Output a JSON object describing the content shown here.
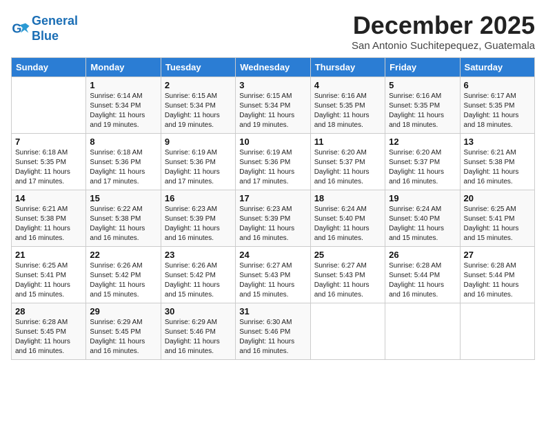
{
  "header": {
    "logo_line1": "General",
    "logo_line2": "Blue",
    "month": "December 2025",
    "location": "San Antonio Suchitepequez, Guatemala"
  },
  "columns": [
    "Sunday",
    "Monday",
    "Tuesday",
    "Wednesday",
    "Thursday",
    "Friday",
    "Saturday"
  ],
  "weeks": [
    [
      {
        "day": "",
        "info": ""
      },
      {
        "day": "1",
        "info": "Sunrise: 6:14 AM\nSunset: 5:34 PM\nDaylight: 11 hours\nand 19 minutes."
      },
      {
        "day": "2",
        "info": "Sunrise: 6:15 AM\nSunset: 5:34 PM\nDaylight: 11 hours\nand 19 minutes."
      },
      {
        "day": "3",
        "info": "Sunrise: 6:15 AM\nSunset: 5:34 PM\nDaylight: 11 hours\nand 19 minutes."
      },
      {
        "day": "4",
        "info": "Sunrise: 6:16 AM\nSunset: 5:35 PM\nDaylight: 11 hours\nand 18 minutes."
      },
      {
        "day": "5",
        "info": "Sunrise: 6:16 AM\nSunset: 5:35 PM\nDaylight: 11 hours\nand 18 minutes."
      },
      {
        "day": "6",
        "info": "Sunrise: 6:17 AM\nSunset: 5:35 PM\nDaylight: 11 hours\nand 18 minutes."
      }
    ],
    [
      {
        "day": "7",
        "info": "Sunrise: 6:18 AM\nSunset: 5:35 PM\nDaylight: 11 hours\nand 17 minutes."
      },
      {
        "day": "8",
        "info": "Sunrise: 6:18 AM\nSunset: 5:36 PM\nDaylight: 11 hours\nand 17 minutes."
      },
      {
        "day": "9",
        "info": "Sunrise: 6:19 AM\nSunset: 5:36 PM\nDaylight: 11 hours\nand 17 minutes."
      },
      {
        "day": "10",
        "info": "Sunrise: 6:19 AM\nSunset: 5:36 PM\nDaylight: 11 hours\nand 17 minutes."
      },
      {
        "day": "11",
        "info": "Sunrise: 6:20 AM\nSunset: 5:37 PM\nDaylight: 11 hours\nand 16 minutes."
      },
      {
        "day": "12",
        "info": "Sunrise: 6:20 AM\nSunset: 5:37 PM\nDaylight: 11 hours\nand 16 minutes."
      },
      {
        "day": "13",
        "info": "Sunrise: 6:21 AM\nSunset: 5:38 PM\nDaylight: 11 hours\nand 16 minutes."
      }
    ],
    [
      {
        "day": "14",
        "info": "Sunrise: 6:21 AM\nSunset: 5:38 PM\nDaylight: 11 hours\nand 16 minutes."
      },
      {
        "day": "15",
        "info": "Sunrise: 6:22 AM\nSunset: 5:38 PM\nDaylight: 11 hours\nand 16 minutes."
      },
      {
        "day": "16",
        "info": "Sunrise: 6:23 AM\nSunset: 5:39 PM\nDaylight: 11 hours\nand 16 minutes."
      },
      {
        "day": "17",
        "info": "Sunrise: 6:23 AM\nSunset: 5:39 PM\nDaylight: 11 hours\nand 16 minutes."
      },
      {
        "day": "18",
        "info": "Sunrise: 6:24 AM\nSunset: 5:40 PM\nDaylight: 11 hours\nand 16 minutes."
      },
      {
        "day": "19",
        "info": "Sunrise: 6:24 AM\nSunset: 5:40 PM\nDaylight: 11 hours\nand 15 minutes."
      },
      {
        "day": "20",
        "info": "Sunrise: 6:25 AM\nSunset: 5:41 PM\nDaylight: 11 hours\nand 15 minutes."
      }
    ],
    [
      {
        "day": "21",
        "info": "Sunrise: 6:25 AM\nSunset: 5:41 PM\nDaylight: 11 hours\nand 15 minutes."
      },
      {
        "day": "22",
        "info": "Sunrise: 6:26 AM\nSunset: 5:42 PM\nDaylight: 11 hours\nand 15 minutes."
      },
      {
        "day": "23",
        "info": "Sunrise: 6:26 AM\nSunset: 5:42 PM\nDaylight: 11 hours\nand 15 minutes."
      },
      {
        "day": "24",
        "info": "Sunrise: 6:27 AM\nSunset: 5:43 PM\nDaylight: 11 hours\nand 15 minutes."
      },
      {
        "day": "25",
        "info": "Sunrise: 6:27 AM\nSunset: 5:43 PM\nDaylight: 11 hours\nand 16 minutes."
      },
      {
        "day": "26",
        "info": "Sunrise: 6:28 AM\nSunset: 5:44 PM\nDaylight: 11 hours\nand 16 minutes."
      },
      {
        "day": "27",
        "info": "Sunrise: 6:28 AM\nSunset: 5:44 PM\nDaylight: 11 hours\nand 16 minutes."
      }
    ],
    [
      {
        "day": "28",
        "info": "Sunrise: 6:28 AM\nSunset: 5:45 PM\nDaylight: 11 hours\nand 16 minutes."
      },
      {
        "day": "29",
        "info": "Sunrise: 6:29 AM\nSunset: 5:45 PM\nDaylight: 11 hours\nand 16 minutes."
      },
      {
        "day": "30",
        "info": "Sunrise: 6:29 AM\nSunset: 5:46 PM\nDaylight: 11 hours\nand 16 minutes."
      },
      {
        "day": "31",
        "info": "Sunrise: 6:30 AM\nSunset: 5:46 PM\nDaylight: 11 hours\nand 16 minutes."
      },
      {
        "day": "",
        "info": ""
      },
      {
        "day": "",
        "info": ""
      },
      {
        "day": "",
        "info": ""
      }
    ]
  ]
}
